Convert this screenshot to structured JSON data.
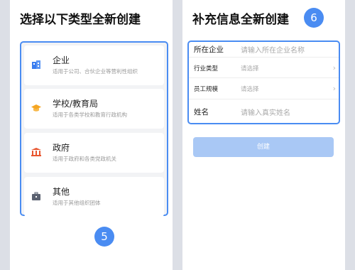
{
  "left": {
    "title": "选择以下类型全新创建",
    "items": [
      {
        "label": "企业",
        "desc": "适用于公司、合伙企业等营利性组织",
        "icon": "building-icon",
        "color": "#3a7df0"
      },
      {
        "label": "学校/教育局",
        "desc": "适用于各类学校和教育行政机构",
        "icon": "graduation-cap-icon",
        "color": "#f5a623"
      },
      {
        "label": "政府",
        "desc": "适用于政府和各类党政机关",
        "icon": "government-building-icon",
        "color": "#e8552f"
      },
      {
        "label": "其他",
        "desc": "适用于其他组织团体",
        "icon": "briefcase-icon",
        "color": "#5a6170"
      }
    ],
    "badge": "5"
  },
  "right": {
    "title": "补充信息全新创建",
    "badge": "6",
    "fields": {
      "company": {
        "label": "所在企业",
        "placeholder": "请输入所在企业名称"
      },
      "industry": {
        "label": "行业类型",
        "value": "请选择"
      },
      "size": {
        "label": "员工规模",
        "value": "请选择"
      },
      "name": {
        "label": "姓名",
        "placeholder": "请输入真实姓名"
      }
    },
    "create_label": "创建"
  },
  "colors": {
    "accent": "#4a8cf2",
    "button_disabled": "#a9c8f5"
  }
}
